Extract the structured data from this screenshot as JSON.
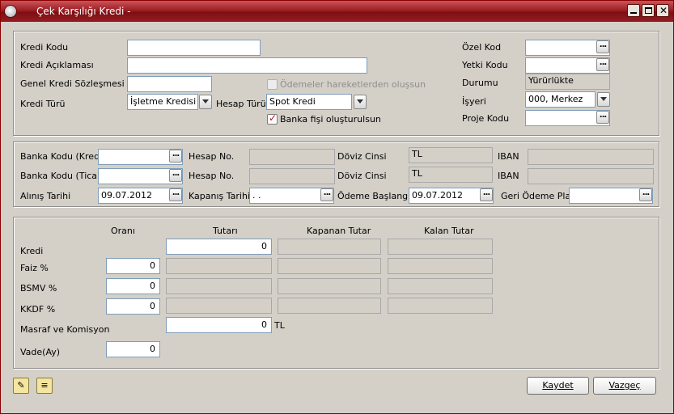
{
  "window": {
    "title": "Çek Karşılığı Kredi -",
    "min_label": "_",
    "max_label": "□",
    "close_label": "✕"
  },
  "top": {
    "kredi_kodu": {
      "label": "Kredi Kodu",
      "value": ""
    },
    "kredi_aciklamasi": {
      "label": "Kredi Açıklaması",
      "value": ""
    },
    "genel_sozlesme": {
      "label": "Genel Kredi Sözleşmesi No.",
      "value": ""
    },
    "odemeler_chk": {
      "label": "Ödemeler hareketlerden oluşsun",
      "checked": false,
      "enabled": false
    },
    "kredi_turu": {
      "label": "Kredi Türü",
      "value": "İşletme Kredisi"
    },
    "hesap_turu": {
      "label": "Hesap Türü",
      "value": "Spot Kredi"
    },
    "banka_fisi_chk": {
      "label": "Banka fişi oluşturulsun",
      "checked": true
    },
    "ozel_kod": {
      "label": "Özel Kod",
      "value": ""
    },
    "yetki_kodu": {
      "label": "Yetki Kodu",
      "value": ""
    },
    "durumu": {
      "label": "Durumu",
      "value": "Yürürlükte"
    },
    "isyeri": {
      "label": "İşyeri",
      "value": "000, Merkez"
    },
    "proje_kodu": {
      "label": "Proje Kodu",
      "value": ""
    }
  },
  "bank": {
    "row1": {
      "banka_label": "Banka Kodu (Kredi)",
      "banka_value": "",
      "hesap_label": "Hesap No.",
      "hesap_value": "",
      "doviz_label": "Döviz Cinsi",
      "doviz_value": "TL",
      "iban_label": "IBAN",
      "iban_value": ""
    },
    "row2": {
      "banka_label": "Banka Kodu (Ticari)",
      "banka_value": "",
      "hesap_label": "Hesap No.",
      "hesap_value": "",
      "doviz_label": "Döviz Cinsi",
      "doviz_value": "TL",
      "iban_label": "IBAN",
      "iban_value": ""
    },
    "row3": {
      "alinis_label": "Alınış Tarihi",
      "alinis_value": "09.07.2012",
      "kapanis_label": "Kapanış Tarihi",
      "kapanis_value": "  .  .",
      "odeme_label": "Ödeme Başlangıcı",
      "odeme_value": "09.07.2012",
      "geri_label": "Geri Ödeme Planı",
      "geri_value": ""
    }
  },
  "amounts": {
    "headers": {
      "orani": "Oranı",
      "tutari": "Tutarı",
      "kapanan": "Kapanan Tutar",
      "kalan": "Kalan Tutar"
    },
    "kredi": {
      "label": "Kredi",
      "tutari": "0"
    },
    "faiz": {
      "label": "Faiz %",
      "orani": "0"
    },
    "bsmv": {
      "label": "BSMV %",
      "orani": "0"
    },
    "kkdf": {
      "label": "KKDF %",
      "orani": "0"
    },
    "masraf": {
      "label": "Masraf ve Komisyon",
      "tutari": "0",
      "currency": "TL"
    },
    "vade": {
      "label": "Vade(Ay)",
      "value": "0"
    }
  },
  "footer": {
    "kaydet": "Kaydet",
    "vazgec": "Vazgeç"
  },
  "glyphs": {
    "dots": "...",
    "icon1": "✎",
    "icon2": "≡"
  }
}
